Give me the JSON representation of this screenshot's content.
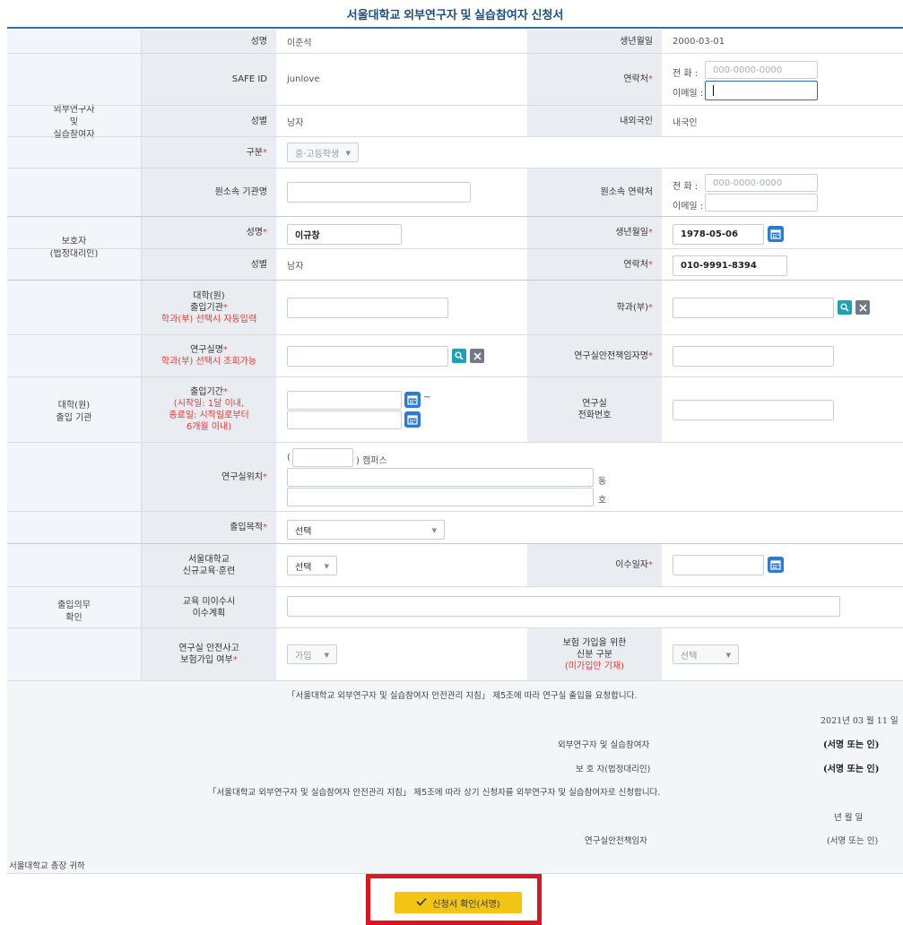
{
  "title": "서울대학교 외부연구자 및 실습참여자 신청서",
  "sections": {
    "researcher": "외부연구자\n및\n실습참여자",
    "guardian": "보호자\n(법정대리인)",
    "entry_org": "대학(원)\n출입 기관",
    "entry_duty": "출입의무\n확인"
  },
  "researcher": {
    "name_label": "성명",
    "name_value": "이준석",
    "birth_label": "생년월일",
    "birth_value": "2000-03-01",
    "safeid_label": "SAFE ID",
    "safeid_value": "junlove",
    "contact_label": "연락처",
    "phone_label": "전 화 :",
    "phone_placeholder": "000-0000-0000",
    "email_label": "이메일 :",
    "gender_label": "성별",
    "gender_value": "남자",
    "nationality_label": "내외국인",
    "nationality_value": "내국인",
    "type_label": "구분",
    "type_value": "중·고등학생",
    "org_label": "원소속 기관명",
    "org_contact_label": "원소속 연락처",
    "org_phone_label": "전 화 :",
    "org_phone_placeholder": "000-0000-0000",
    "org_email_label": "이메일 :"
  },
  "guardian": {
    "name_label": "성명",
    "name_value": "이규창",
    "birth_label": "생년월일",
    "birth_value": "1978-05-06",
    "gender_label": "성별",
    "gender_value": "남자",
    "contact_label": "연락처",
    "contact_value": "010-9991-8394"
  },
  "entry": {
    "org_label": "대학(원)\n출입기관",
    "org_note": "학과(부) 선택시 자동입력",
    "dept_label": "학과(부)",
    "lab_label": "연구실명",
    "lab_note": "학과(부) 선택시 조회가능",
    "safety_manager_label": "연구실안전책임자명",
    "period_label": "출입기간",
    "period_note": "(시작일: 1달 이내,\n종료일: 시작일로부터\n6개월 이내)",
    "period_dash": "~",
    "lab_phone_label": "연구실\n전화번호",
    "location_label": "연구실위치",
    "campus_open": "(",
    "campus_suffix": ") 캠퍼스",
    "building_suffix": "동",
    "room_suffix": "호",
    "purpose_label": "출입목적",
    "purpose_value": "선택"
  },
  "duty": {
    "training_label": "서울대학교\n신규교육·훈련",
    "training_value": "선택",
    "completion_label": "이수일자",
    "plan_label": "교육 미이수시\n이수계획",
    "insurance_label": "연구실 안전사고\n보험가입 여부",
    "insurance_value": "가입",
    "status_label": "보험 가입을 위한\n신분 구분",
    "status_note": "(미가입만 기재)",
    "status_value": "선택"
  },
  "statement": {
    "line1": "「서울대학교 외부연구자 및 실습참여자 안전관리 지침」 제5조에 따라 연구실 출입을 요청합니다.",
    "date": "2021년 03 월 11 일",
    "applicant_label": "외부연구자 및 실습참여자",
    "applicant_sign": "(서명 또는 인)",
    "guardian_label": "보 호 자(법정대리인)",
    "guardian_sign": "(서명 또는 인)",
    "line2": "「서울대학교 외부연구자 및 실습참여자 안전관리 지침」 제5조에 따라 상기 신청자를 외부연구자 및 실습참여자로 신청합니다.",
    "date2": "년   월   일",
    "manager_label": "연구실안전책임자",
    "manager_sign": "(서명 또는 인)",
    "addressee": "서울대학교 총장 귀하"
  },
  "submit_label": "신청서 확인(서명)",
  "required_mark": "*",
  "colors": {
    "accent": "#2f6ea5",
    "button": "#f2c414",
    "highlight": "#e0141e"
  }
}
